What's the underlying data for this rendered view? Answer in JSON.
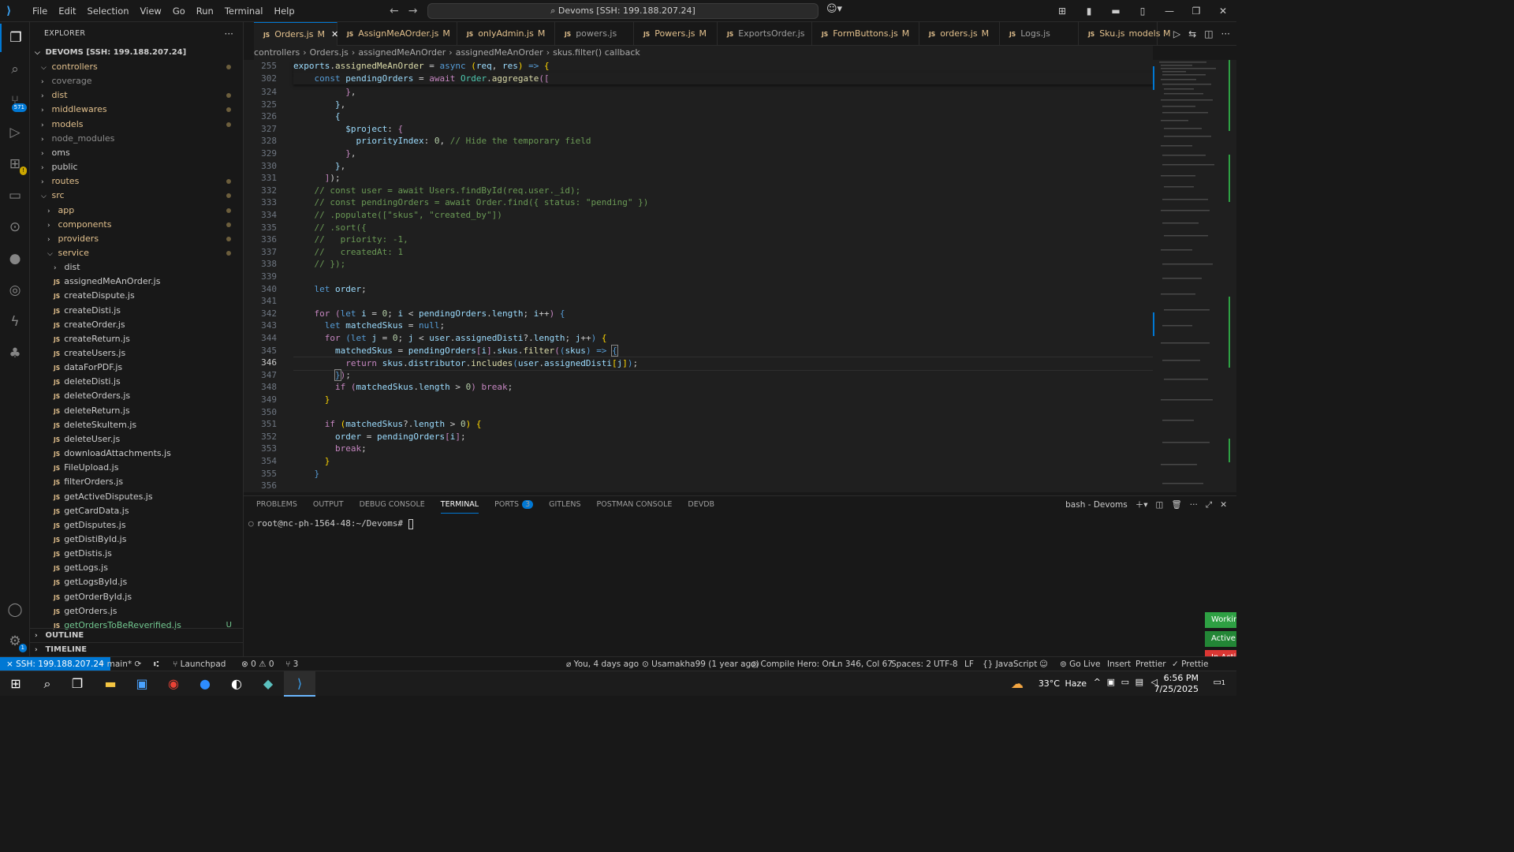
{
  "menu": [
    "File",
    "Edit",
    "Selection",
    "View",
    "Go",
    "Run",
    "Terminal",
    "Help"
  ],
  "command_center": "Devoms [SSH: 199.188.207.24]",
  "activity": {
    "scm_badge": "571",
    "settings_badge": "1"
  },
  "explorer": {
    "title": "EXPLORER",
    "root": "DEVOMS [SSH: 199.188.207.24]",
    "items": [
      {
        "label": "controllers",
        "depth": 1,
        "type": "folder-open",
        "dot": true
      },
      {
        "label": "coverage",
        "depth": 1,
        "type": "folder",
        "dot": false,
        "dim": true
      },
      {
        "label": "dist",
        "depth": 1,
        "type": "folder",
        "dot": true
      },
      {
        "label": "middlewares",
        "depth": 1,
        "type": "folder",
        "dot": true
      },
      {
        "label": "models",
        "depth": 1,
        "type": "folder",
        "dot": true
      },
      {
        "label": "node_modules",
        "depth": 1,
        "type": "folder",
        "dot": false,
        "dim": true
      },
      {
        "label": "oms",
        "depth": 1,
        "type": "folder",
        "dot": false
      },
      {
        "label": "public",
        "depth": 1,
        "type": "folder",
        "dot": false
      },
      {
        "label": "routes",
        "depth": 1,
        "type": "folder",
        "dot": true
      },
      {
        "label": "src",
        "depth": 1,
        "type": "folder-open",
        "dot": true
      },
      {
        "label": "app",
        "depth": 2,
        "type": "folder",
        "dot": true
      },
      {
        "label": "components",
        "depth": 2,
        "type": "folder",
        "dot": true
      },
      {
        "label": "providers",
        "depth": 2,
        "type": "folder",
        "dot": true
      },
      {
        "label": "service",
        "depth": 2,
        "type": "folder-open",
        "dot": true
      },
      {
        "label": "dist",
        "depth": 3,
        "type": "folder",
        "dot": false
      },
      {
        "label": "assignedMeAnOrder.js",
        "depth": 3,
        "type": "file"
      },
      {
        "label": "createDispute.js",
        "depth": 3,
        "type": "file"
      },
      {
        "label": "createDisti.js",
        "depth": 3,
        "type": "file"
      },
      {
        "label": "createOrder.js",
        "depth": 3,
        "type": "file"
      },
      {
        "label": "createReturn.js",
        "depth": 3,
        "type": "file"
      },
      {
        "label": "createUsers.js",
        "depth": 3,
        "type": "file"
      },
      {
        "label": "dataForPDF.js",
        "depth": 3,
        "type": "file"
      },
      {
        "label": "deleteDisti.js",
        "depth": 3,
        "type": "file"
      },
      {
        "label": "deleteOrders.js",
        "depth": 3,
        "type": "file"
      },
      {
        "label": "deleteReturn.js",
        "depth": 3,
        "type": "file"
      },
      {
        "label": "deleteSkuItem.js",
        "depth": 3,
        "type": "file"
      },
      {
        "label": "deleteUser.js",
        "depth": 3,
        "type": "file"
      },
      {
        "label": "downloadAttachments.js",
        "depth": 3,
        "type": "file"
      },
      {
        "label": "FileUpload.js",
        "depth": 3,
        "type": "file"
      },
      {
        "label": "filterOrders.js",
        "depth": 3,
        "type": "file"
      },
      {
        "label": "getActiveDisputes.js",
        "depth": 3,
        "type": "file"
      },
      {
        "label": "getCardData.js",
        "depth": 3,
        "type": "file"
      },
      {
        "label": "getDisputes.js",
        "depth": 3,
        "type": "file"
      },
      {
        "label": "getDistiById.js",
        "depth": 3,
        "type": "file"
      },
      {
        "label": "getDistis.js",
        "depth": 3,
        "type": "file"
      },
      {
        "label": "getLogs.js",
        "depth": 3,
        "type": "file"
      },
      {
        "label": "getLogsById.js",
        "depth": 3,
        "type": "file"
      },
      {
        "label": "getOrderById.js",
        "depth": 3,
        "type": "file"
      },
      {
        "label": "getOrders.js",
        "depth": 3,
        "type": "file"
      },
      {
        "label": "getOrdersToBeReverified.js",
        "depth": 3,
        "type": "file",
        "untracked": "U"
      }
    ],
    "outline": "OUTLINE",
    "timeline": "TIMELINE"
  },
  "tabs": [
    {
      "label": "Orders.js",
      "status": "M",
      "active": true
    },
    {
      "label": "AssignMeAOrder.js",
      "status": "M"
    },
    {
      "label": "onlyAdmin.js",
      "status": "M"
    },
    {
      "label": "powers.js",
      "status": ""
    },
    {
      "label": "Powers.js",
      "status": "M"
    },
    {
      "label": "ExportsOrder.js",
      "status": ""
    },
    {
      "label": "FormButtons.js",
      "status": "M"
    },
    {
      "label": "orders.js",
      "status": "M"
    },
    {
      "label": "Logs.js",
      "status": ""
    },
    {
      "label": "Sku.js",
      "status": "models M"
    }
  ],
  "breadcrumbs": [
    "controllers",
    ">",
    "Orders.js",
    ">",
    "assignedMeAnOrder",
    ">",
    "assignedMeAnOrder",
    ">",
    "skus.filter() callback"
  ],
  "editor": {
    "current_line": "346",
    "lines": [
      {
        "n": "255",
        "sticky": true
      },
      {
        "n": "302",
        "sticky": true
      },
      {
        "n": "324"
      },
      {
        "n": "325"
      },
      {
        "n": "326"
      },
      {
        "n": "327"
      },
      {
        "n": "328"
      },
      {
        "n": "329"
      },
      {
        "n": "330"
      },
      {
        "n": "331"
      },
      {
        "n": "332"
      },
      {
        "n": "333"
      },
      {
        "n": "334"
      },
      {
        "n": "335"
      },
      {
        "n": "336"
      },
      {
        "n": "337"
      },
      {
        "n": "338"
      },
      {
        "n": "339"
      },
      {
        "n": "340"
      },
      {
        "n": "341"
      },
      {
        "n": "342"
      },
      {
        "n": "343"
      },
      {
        "n": "344"
      },
      {
        "n": "345"
      },
      {
        "n": "346"
      },
      {
        "n": "347"
      },
      {
        "n": "348"
      },
      {
        "n": "349"
      },
      {
        "n": "350"
      },
      {
        "n": "351"
      },
      {
        "n": "352"
      },
      {
        "n": "353"
      },
      {
        "n": "354"
      },
      {
        "n": "355"
      },
      {
        "n": "356"
      }
    ]
  },
  "panel": {
    "tabs": [
      "PROBLEMS",
      "OUTPUT",
      "DEBUG CONSOLE",
      "TERMINAL",
      "PORTS",
      "GITLENS",
      "POSTMAN CONSOLE",
      "DEVDB"
    ],
    "ports_badge": "3",
    "active": "TERMINAL",
    "shell": "bash - Devoms",
    "prompt": "root@nc-ph-1564-48:~/Devoms#"
  },
  "notifications": [
    "Workin",
    "Active:",
    "In Acti"
  ],
  "status": {
    "remote": "SSH: 199.188.207.24",
    "branch": "main*",
    "launchpad": "Launchpad",
    "errors": "0",
    "warnings": "0",
    "ports": "3",
    "blame": "You, 4 days ago",
    "author": "Usamakha99 (1 year ago)",
    "compile": "Compile Hero: On",
    "position": "Ln 346, Col 67",
    "spaces": "Spaces: 2",
    "encoding": "UTF-8",
    "eol": "LF",
    "language": "JavaScript",
    "golive": "Go Live",
    "insert": "Insert",
    "prettier1": "Prettier",
    "prettier2": "Prettie"
  },
  "taskbar": {
    "weather": "33°C",
    "weather_desc": "Haze",
    "time": "6:56 PM",
    "date": "7/25/2025",
    "notif_count": "1"
  },
  "colors": {
    "accent": "#0078d4",
    "editor_bg": "#1f1f1f",
    "chrome_bg": "#181818"
  }
}
